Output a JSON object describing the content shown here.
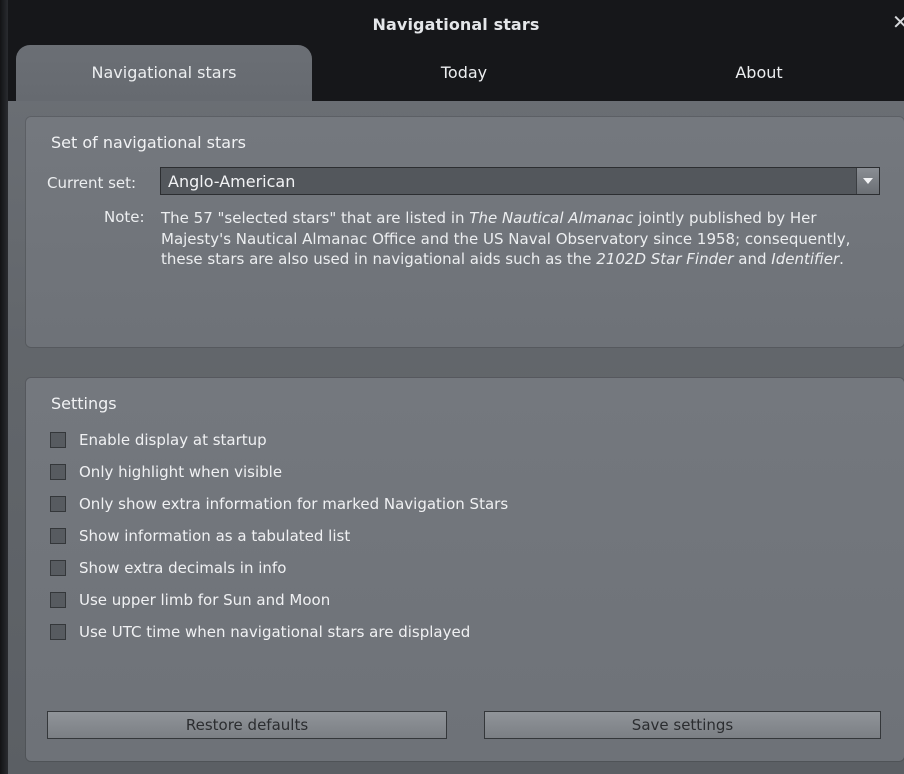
{
  "window": {
    "title": "Navigational stars",
    "close_glyph": "✕"
  },
  "tabs": [
    {
      "label": "Navigational stars",
      "active": true
    },
    {
      "label": "Today",
      "active": false
    },
    {
      "label": "About",
      "active": false
    }
  ],
  "set_panel": {
    "title": "Set of navigational stars",
    "current_label": "Current set:",
    "current_value": "Anglo-American",
    "note_label": "Note:",
    "note_parts": [
      {
        "text": "The 57 \"selected stars\" that are listed in ",
        "italic": false
      },
      {
        "text": "The Nautical Almanac",
        "italic": true
      },
      {
        "text": " jointly published by Her Majesty's Nautical Almanac Office and the US Naval Observatory since 1958; consequently, these stars are also used in navigational aids such as the ",
        "italic": false
      },
      {
        "text": "2102D Star Finder",
        "italic": true
      },
      {
        "text": " and ",
        "italic": false
      },
      {
        "text": "Identifier",
        "italic": true
      },
      {
        "text": ".",
        "italic": false
      }
    ]
  },
  "settings_panel": {
    "title": "Settings",
    "options": [
      {
        "label": "Enable display at startup",
        "checked": false
      },
      {
        "label": "Only highlight when visible",
        "checked": false
      },
      {
        "label": "Only show extra information for marked Navigation Stars",
        "checked": false
      },
      {
        "label": "Show information as a tabulated list",
        "checked": false
      },
      {
        "label": "Show extra decimals in info",
        "checked": false
      },
      {
        "label": "Use upper limb for Sun and Moon",
        "checked": false
      },
      {
        "label": "Use UTC time when navigational stars are displayed",
        "checked": false
      }
    ],
    "restore_label": "Restore defaults",
    "save_label": "Save settings"
  },
  "colors": {
    "titlebar": "#16171a",
    "panel": "#74787e",
    "text": "#eceef0"
  }
}
